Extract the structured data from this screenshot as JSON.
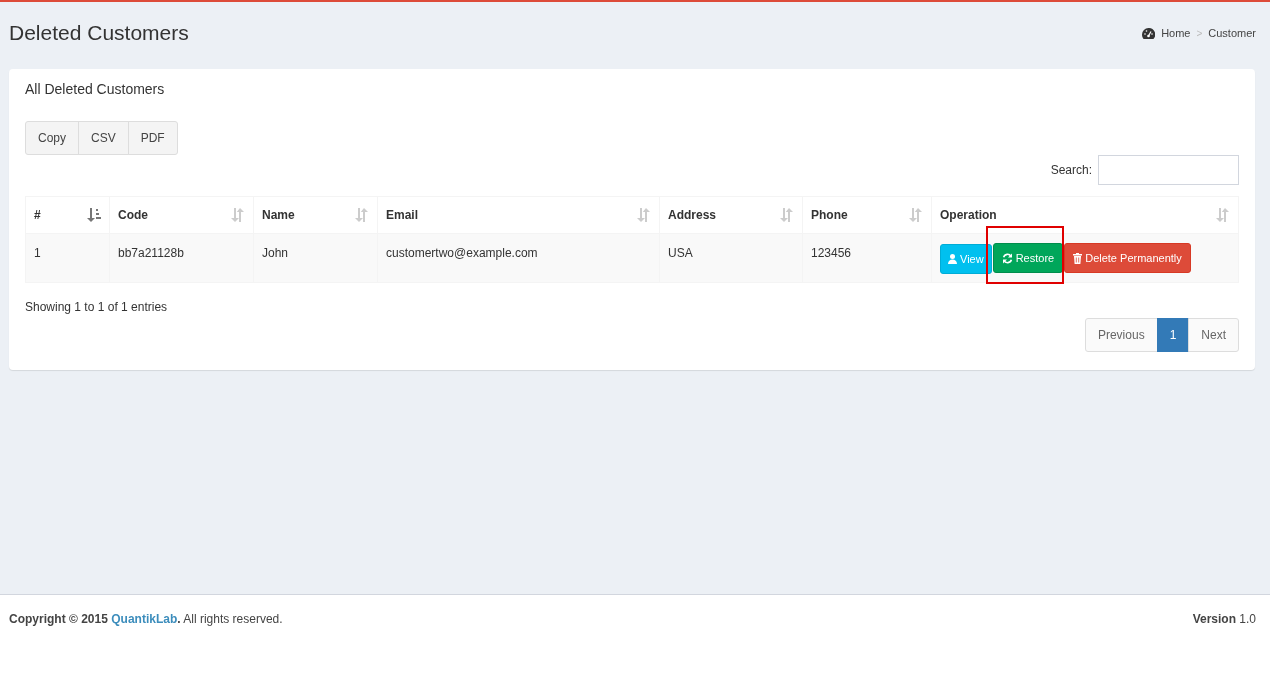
{
  "page": {
    "title": "Deleted Customers"
  },
  "breadcrumb": [
    {
      "label": "Home",
      "kind": "home"
    },
    {
      "label": ">",
      "kind": "separator"
    },
    {
      "label": "Customer",
      "kind": "current"
    }
  ],
  "card": {
    "title": "All Deleted Customers"
  },
  "export_buttons": [
    "Copy",
    "CSV",
    "PDF"
  ],
  "search": {
    "label": "Search:"
  },
  "table": {
    "columns": [
      {
        "label": "#",
        "sorted": true
      },
      {
        "label": "Code",
        "sorted": false
      },
      {
        "label": "Name",
        "sorted": false
      },
      {
        "label": "Email",
        "sorted": false
      },
      {
        "label": "Address",
        "sorted": false
      },
      {
        "label": "Phone",
        "sorted": false
      },
      {
        "label": "Operation",
        "sorted": false
      }
    ],
    "rows": [
      {
        "cells": [
          "1",
          "bb7a21128b",
          "John",
          "customertwo@example.com",
          "USA",
          "123456"
        ],
        "actions": [
          {
            "label": "View",
            "kind": "view",
            "highlighted": false
          },
          {
            "label": "Restore",
            "kind": "restore",
            "highlighted": true
          },
          {
            "label": "Delete Permanently",
            "kind": "delete",
            "highlighted": false
          }
        ]
      }
    ]
  },
  "info": "Showing 1 to 1 of 1 entries",
  "pagination": [
    {
      "label": "Previous",
      "selected": false
    },
    {
      "label": "1",
      "selected": true
    },
    {
      "label": "Next",
      "selected": false
    }
  ],
  "footer": {
    "copyright": "**Copyright © 2015**",
    "link": "QuantikLab",
    "rest": "**.** All rights reserved.",
    "version": "**Version** 1.0"
  }
}
